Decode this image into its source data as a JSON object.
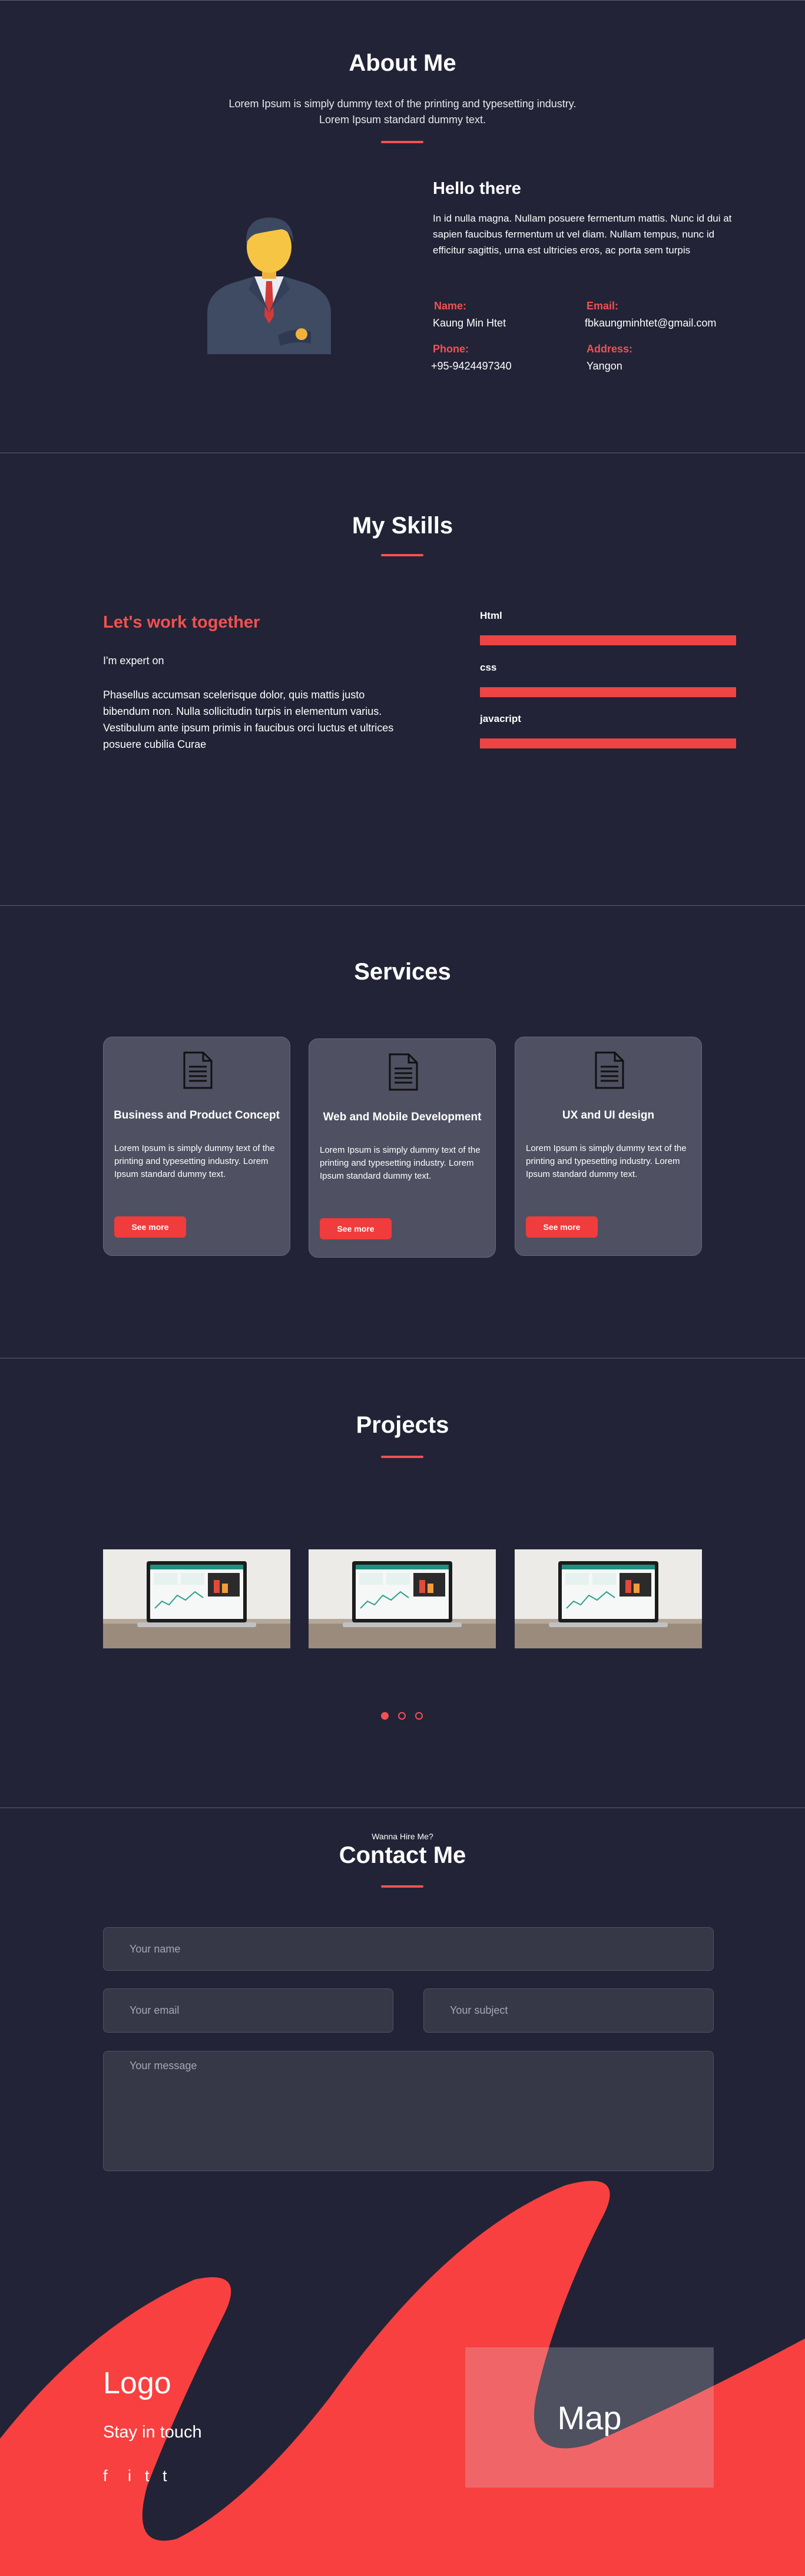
{
  "about": {
    "title": "About Me",
    "intro": "Lorem Ipsum is simply dummy text of the printing and typesetting industry. Lorem Ipsum standard dummy text.",
    "hello": "Hello there",
    "body": "In id nulla magna. Nullam posuere fermentum mattis. Nunc id dui at sapien faucibus fermentum ut vel diam.  Nullam tempus, nunc id efficitur sagittis, urna est ultricies eros, ac porta sem turpis",
    "info": {
      "name_label": "Name:",
      "name": "Kaung Min Htet",
      "email_label": "Email:",
      "email": "fbkaungminhtet@gmail.com",
      "phone_label": "Phone:",
      "phone": "+95-9424497340",
      "address_label": "Address:",
      "address": "Yangon"
    }
  },
  "skills": {
    "title": "My Skills",
    "heading": "Let's work together",
    "expert": "I'm expert on",
    "body": "Phasellus accumsan scelerisque dolor, quis mattis justo bibendum non. Nulla sollicitudin turpis in elementum varius. Vestibulum ante ipsum primis in faucibus orci luctus et ultrices posuere cubilia Curae",
    "items": [
      {
        "name": "Html",
        "level": 1.0
      },
      {
        "name": "css",
        "level": 1.0
      },
      {
        "name": "javacript",
        "level": 1.0
      }
    ],
    "bar_color": "#ee4444"
  },
  "services": {
    "title": "Services",
    "icon": "document-icon",
    "cards": [
      {
        "title": "Business and Product Concept",
        "text": "Lorem Ipsum is simply dummy text of the printing and typesetting industry. Lorem Ipsum standard dummy text.",
        "button": "See more"
      },
      {
        "title": "Web and Mobile Development",
        "text": "Lorem Ipsum is simply dummy text of the printing and typesetting industry. Lorem Ipsum standard dummy text.",
        "button": "See more"
      },
      {
        "title": "UX and UI design",
        "text": "Lorem Ipsum is simply dummy text of the printing and typesetting industry. Lorem Ipsum standard dummy text.",
        "button": "See more"
      }
    ]
  },
  "projects": {
    "title": "Projects",
    "image_desc": "laptop-dashboard-image",
    "active_dot": 0,
    "dot_count": 3
  },
  "contact": {
    "pre": "Wanna Hire Me?",
    "title": "Contact Me",
    "name_placeholder": "Your name",
    "email_placeholder": "Your email",
    "subject_placeholder": "Your subject",
    "message_placeholder": "Your message"
  },
  "footer": {
    "logo": "Logo",
    "tagline": "Stay in touch",
    "social": [
      "f",
      "i",
      "t",
      "t"
    ],
    "map": "Map"
  },
  "colors": {
    "background": "#222336",
    "accent": "#f25151",
    "card": "#4f5061",
    "blob": "#f84040"
  }
}
